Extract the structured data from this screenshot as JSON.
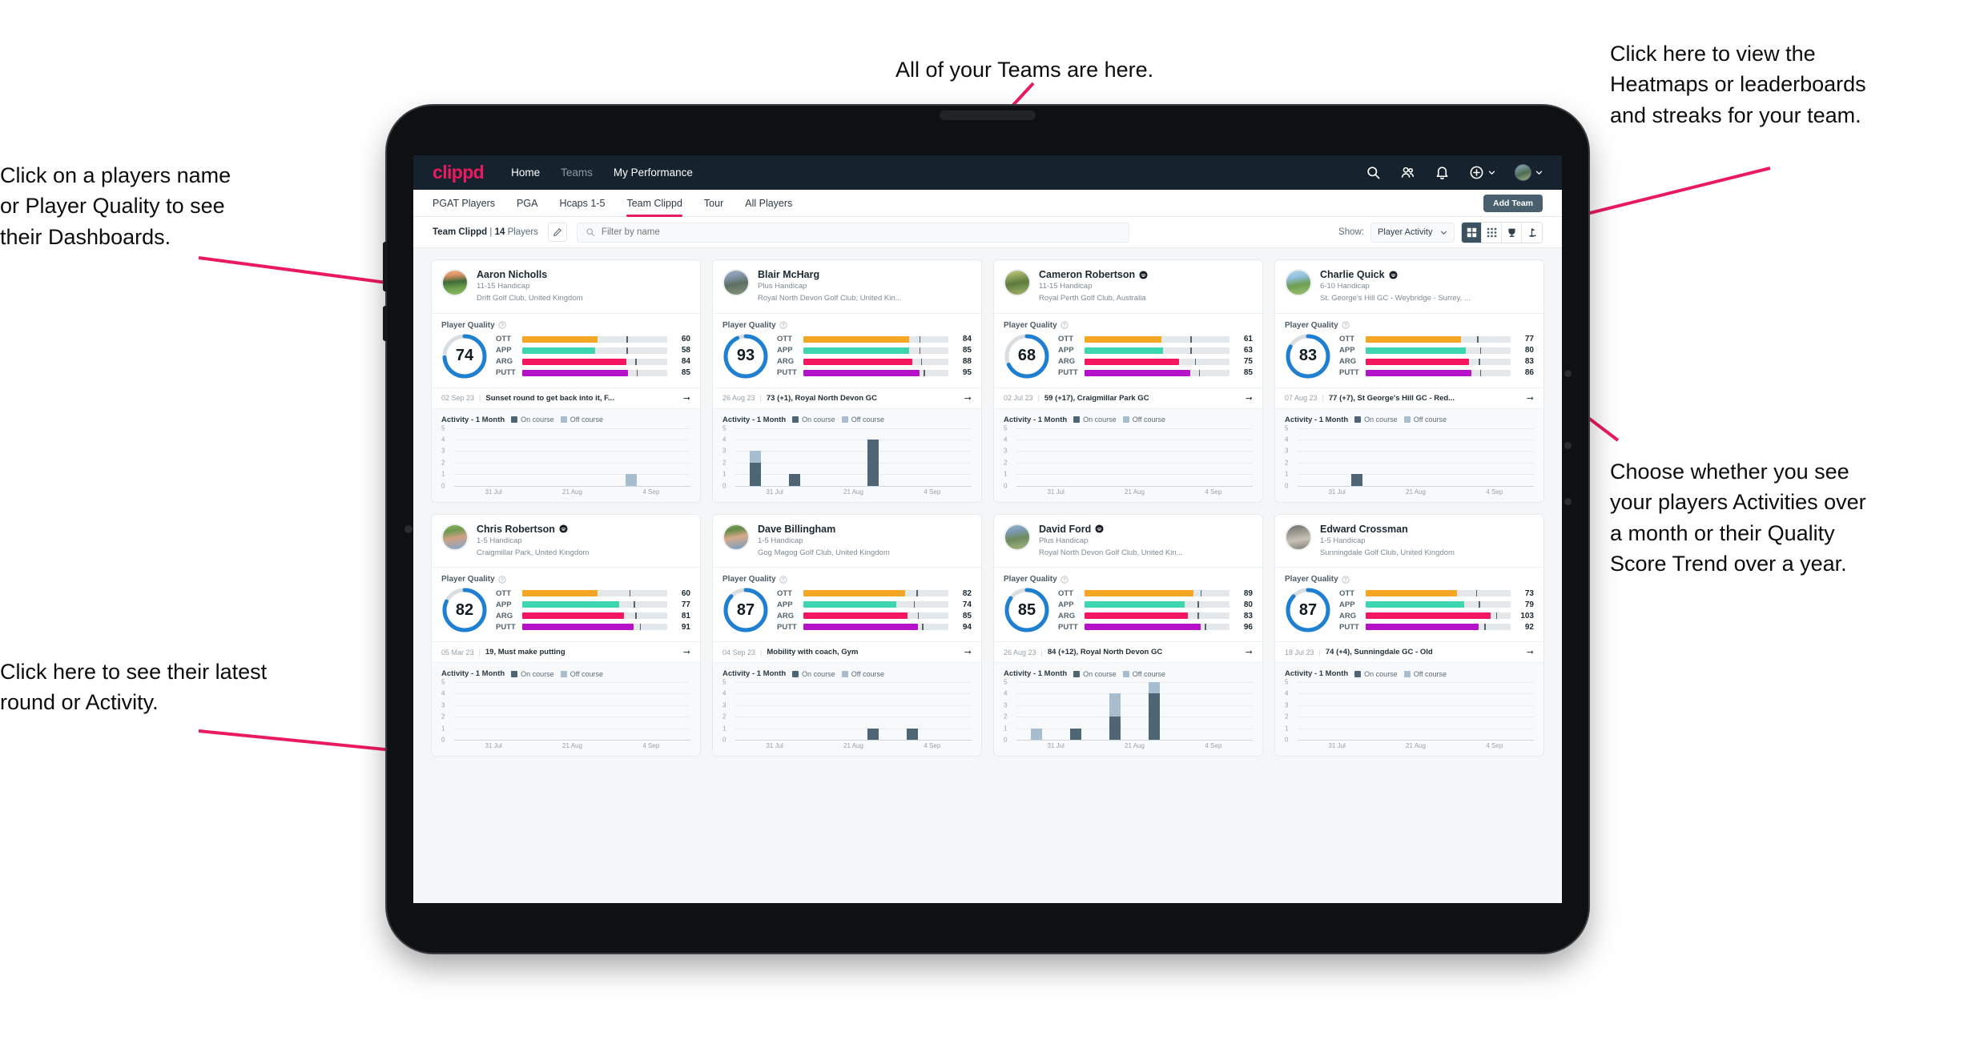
{
  "annotations": [
    {
      "id": "players-name",
      "text": "Click on a players name\nor Player Quality to see\ntheir Dashboards."
    },
    {
      "id": "teams-here",
      "text": "All of your Teams are here."
    },
    {
      "id": "heatmaps",
      "text": "Click here to view the\nHeatmaps or leaderboards\nand streaks for your team."
    },
    {
      "id": "choose-view",
      "text": "Choose whether you see\nyour players Activities over\na month or their Quality\nScore Trend over a year."
    },
    {
      "id": "latest-round",
      "text": "Click here to see their latest\nround or Activity."
    }
  ],
  "accent": "#ea1a5f",
  "navbar": {
    "brand": "clippd",
    "links": [
      {
        "label": "Home",
        "active": true
      },
      {
        "label": "Teams",
        "active": false
      },
      {
        "label": "My Performance",
        "active": true
      }
    ],
    "icons": [
      "search-icon",
      "people-icon",
      "bell-icon",
      "plus-circle-icon",
      "avatar"
    ]
  },
  "tabs": {
    "items": [
      {
        "label": "PGAT Players",
        "active": false
      },
      {
        "label": "PGA",
        "active": false
      },
      {
        "label": "Hcaps 1-5",
        "active": false
      },
      {
        "label": "Team Clippd",
        "active": true
      },
      {
        "label": "Tour",
        "active": false
      },
      {
        "label": "All Players",
        "active": false
      }
    ],
    "add_team_label": "Add Team"
  },
  "toolbar": {
    "team_name": "Team Clippd",
    "separator": "|",
    "player_count": "14",
    "players_word": "Players",
    "search_placeholder": "Filter by name",
    "search_value": "",
    "show_label": "Show:",
    "show_value": "Player Activity",
    "views": [
      {
        "name": "grid-large-view",
        "active": true
      },
      {
        "name": "grid-small-view",
        "active": false
      },
      {
        "name": "trophy-view",
        "active": false
      },
      {
        "name": "golf-flag-view",
        "active": false
      }
    ]
  },
  "card_labels": {
    "player_quality": "Player Quality",
    "activity_title": "Activity - 1 Month",
    "legend_on": "On course",
    "legend_off": "Off course"
  },
  "chart_data": {
    "type": "bar",
    "title": "Activity - 1 Month",
    "ylim": [
      0,
      5
    ],
    "yticks": [
      5,
      4,
      3,
      2,
      1,
      0
    ],
    "xticks": [
      "31 Jul",
      "21 Aug",
      "4 Sep"
    ],
    "series_names": [
      "On course",
      "Off course"
    ],
    "colors": {
      "on_course": "#4e6575",
      "off_course": "#a7bed0"
    },
    "charts": [
      {
        "player": "Aaron Nicholls",
        "bars": [
          {
            "on": 0,
            "off": 0
          },
          {
            "on": 0,
            "off": 0
          },
          {
            "on": 0,
            "off": 0
          },
          {
            "on": 0,
            "off": 0
          },
          {
            "on": 0,
            "off": 1
          },
          {
            "on": 0,
            "off": 0
          }
        ]
      },
      {
        "player": "Blair McHarg",
        "bars": [
          {
            "on": 2,
            "off": 1
          },
          {
            "on": 1,
            "off": 0
          },
          {
            "on": 0,
            "off": 0
          },
          {
            "on": 4,
            "off": 0
          },
          {
            "on": 0,
            "off": 0
          },
          {
            "on": 0,
            "off": 0
          }
        ]
      },
      {
        "player": "Cameron Robertson",
        "bars": [
          {
            "on": 0,
            "off": 0
          },
          {
            "on": 0,
            "off": 0
          },
          {
            "on": 0,
            "off": 0
          },
          {
            "on": 0,
            "off": 0
          },
          {
            "on": 0,
            "off": 0
          },
          {
            "on": 0,
            "off": 0
          }
        ]
      },
      {
        "player": "Charlie Quick",
        "bars": [
          {
            "on": 0,
            "off": 0
          },
          {
            "on": 1,
            "off": 0
          },
          {
            "on": 0,
            "off": 0
          },
          {
            "on": 0,
            "off": 0
          },
          {
            "on": 0,
            "off": 0
          },
          {
            "on": 0,
            "off": 0
          }
        ]
      },
      {
        "player": "Chris Robertson",
        "bars": [
          {
            "on": 0,
            "off": 0
          },
          {
            "on": 0,
            "off": 0
          },
          {
            "on": 0,
            "off": 0
          },
          {
            "on": 0,
            "off": 0
          },
          {
            "on": 0,
            "off": 0
          },
          {
            "on": 0,
            "off": 0
          }
        ]
      },
      {
        "player": "Dave Billingham",
        "bars": [
          {
            "on": 0,
            "off": 0
          },
          {
            "on": 0,
            "off": 0
          },
          {
            "on": 0,
            "off": 0
          },
          {
            "on": 1,
            "off": 0
          },
          {
            "on": 1,
            "off": 0
          },
          {
            "on": 0,
            "off": 0
          }
        ]
      },
      {
        "player": "David Ford",
        "bars": [
          {
            "on": 0,
            "off": 1
          },
          {
            "on": 1,
            "off": 0
          },
          {
            "on": 2,
            "off": 2
          },
          {
            "on": 4,
            "off": 1
          },
          {
            "on": 0,
            "off": 0
          },
          {
            "on": 0,
            "off": 0
          }
        ]
      },
      {
        "player": "Edward Crossman",
        "bars": [
          {
            "on": 0,
            "off": 0
          },
          {
            "on": 0,
            "off": 0
          },
          {
            "on": 0,
            "off": 0
          },
          {
            "on": 0,
            "off": 0
          },
          {
            "on": 0,
            "off": 0
          },
          {
            "on": 0,
            "off": 0
          }
        ]
      }
    ]
  },
  "stat_colors": {
    "OTT": "#f5a623",
    "APP": "#3ed6b0",
    "ARG": "#f4175f",
    "PUTT": "#b511c9",
    "ring": "#1f7fd1",
    "ring_track": "#d9dee2"
  },
  "players": [
    {
      "name": "Aaron Nicholls",
      "verified": false,
      "handicap": "11-15 Handicap",
      "club": "Drift Golf Club, United Kingdom",
      "quality": 74,
      "ring_pct": 74,
      "avatar_css": "linear-gradient(175deg,#f0b57e 0%,#d98f63 22%,#3f6b3a 46%,#6ea04e 72%,#8dba63 100%)",
      "stats": [
        {
          "label": "OTT",
          "value": 60,
          "fill": 52,
          "tick": 72
        },
        {
          "label": "APP",
          "value": 58,
          "fill": 50,
          "tick": 72
        },
        {
          "label": "ARG",
          "value": 84,
          "fill": 72,
          "tick": 78
        },
        {
          "label": "PUTT",
          "value": 85,
          "fill": 73,
          "tick": 79
        }
      ],
      "round": {
        "date": "02 Sep 23",
        "desc": "Sunset round to get back into it, F..."
      }
    },
    {
      "name": "Blair McHarg",
      "verified": false,
      "handicap": "Plus Handicap",
      "club": "Royal North Devon Golf Club, United Kin...",
      "quality": 93,
      "ring_pct": 93,
      "avatar_css": "linear-gradient(170deg,#9fb4c6 0%,#7f93a5 30%,#5d6f62 55%,#86977c 100%)",
      "stats": [
        {
          "label": "OTT",
          "value": 84,
          "fill": 73,
          "tick": 80
        },
        {
          "label": "APP",
          "value": 85,
          "fill": 73,
          "tick": 80
        },
        {
          "label": "ARG",
          "value": 88,
          "fill": 75,
          "tick": 81
        },
        {
          "label": "PUTT",
          "value": 95,
          "fill": 80,
          "tick": 83
        }
      ],
      "round": {
        "date": "26 Aug 23",
        "desc": "73 (+1), Royal North Devon GC"
      }
    },
    {
      "name": "Cameron Robertson",
      "verified": true,
      "handicap": "11-15 Handicap",
      "club": "Royal Perth Golf Club, Australia",
      "quality": 68,
      "ring_pct": 68,
      "avatar_css": "linear-gradient(170deg,#c8d088 0%,#8fa05a 28%,#5c7a3c 52%,#a8b96f 100%)",
      "stats": [
        {
          "label": "OTT",
          "value": 61,
          "fill": 53,
          "tick": 73
        },
        {
          "label": "APP",
          "value": 63,
          "fill": 54,
          "tick": 73
        },
        {
          "label": "ARG",
          "value": 75,
          "fill": 65,
          "tick": 76
        },
        {
          "label": "PUTT",
          "value": 85,
          "fill": 73,
          "tick": 79
        }
      ],
      "round": {
        "date": "02 Jul 23",
        "desc": "59 (+17), Craigmillar Park GC"
      }
    },
    {
      "name": "Charlie Quick",
      "verified": true,
      "handicap": "6-10 Handicap",
      "club": "St. George's Hill GC - Weybridge - Surrey, ...",
      "quality": 83,
      "ring_pct": 83,
      "avatar_css": "linear-gradient(170deg,#b9d7ea 0%,#8fc0dd 30%,#6d9e52 58%,#9dc472 100%)",
      "stats": [
        {
          "label": "OTT",
          "value": 77,
          "fill": 66,
          "tick": 77
        },
        {
          "label": "APP",
          "value": 80,
          "fill": 69,
          "tick": 79
        },
        {
          "label": "ARG",
          "value": 83,
          "fill": 71,
          "tick": 78
        },
        {
          "label": "PUTT",
          "value": 86,
          "fill": 73,
          "tick": 79
        }
      ],
      "round": {
        "date": "07 Aug 23",
        "desc": "77 (+7), St George's Hill GC - Red..."
      }
    },
    {
      "name": "Chris Robertson",
      "verified": true,
      "handicap": "1-5 Handicap",
      "club": "Craigmillar Park, United Kingdom",
      "quality": 82,
      "ring_pct": 82,
      "avatar_css": "linear-gradient(170deg,#89b45f 0%,#6f9a4c 25%,#cfa083 52%,#7fa8cf 100%)",
      "stats": [
        {
          "label": "OTT",
          "value": 60,
          "fill": 52,
          "tick": 74
        },
        {
          "label": "APP",
          "value": 77,
          "fill": 67,
          "tick": 77
        },
        {
          "label": "ARG",
          "value": 81,
          "fill": 70,
          "tick": 78
        },
        {
          "label": "PUTT",
          "value": 91,
          "fill": 77,
          "tick": 81
        }
      ],
      "round": {
        "date": "05 Mar 23",
        "desc": "19, Must make putting"
      }
    },
    {
      "name": "Dave Billingham",
      "verified": false,
      "handicap": "1-5 Handicap",
      "club": "Gog Magog Golf Club, United Kingdom",
      "quality": 87,
      "ring_pct": 87,
      "avatar_css": "linear-gradient(170deg,#7fa95a 0%,#628c47 22%,#d8a98c 50%,#6f9ec4 100%)",
      "stats": [
        {
          "label": "OTT",
          "value": 82,
          "fill": 70,
          "tick": 78
        },
        {
          "label": "APP",
          "value": 74,
          "fill": 64,
          "tick": 76
        },
        {
          "label": "ARG",
          "value": 85,
          "fill": 72,
          "tick": 79
        },
        {
          "label": "PUTT",
          "value": 94,
          "fill": 79,
          "tick": 82
        }
      ],
      "round": {
        "date": "04 Sep 23",
        "desc": "Mobility with coach, Gym"
      }
    },
    {
      "name": "David Ford",
      "verified": true,
      "handicap": "Plus Handicap",
      "club": "Royal North Devon Golf Club, United Kin...",
      "quality": 85,
      "ring_pct": 85,
      "avatar_css": "linear-gradient(170deg,#9cb8cf 0%,#7d9bb4 25%,#6e8a5e 55%,#a6b884 100%)",
      "stats": [
        {
          "label": "OTT",
          "value": 89,
          "fill": 75,
          "tick": 80
        },
        {
          "label": "APP",
          "value": 80,
          "fill": 69,
          "tick": 78
        },
        {
          "label": "ARG",
          "value": 83,
          "fill": 71,
          "tick": 78
        },
        {
          "label": "PUTT",
          "value": 96,
          "fill": 80,
          "tick": 83
        }
      ],
      "round": {
        "date": "26 Aug 23",
        "desc": "84 (+12), Royal North Devon GC"
      }
    },
    {
      "name": "Edward Crossman",
      "verified": false,
      "handicap": "1-5 Handicap",
      "club": "Sunningdale Golf Club, United Kingdom",
      "quality": 87,
      "ring_pct": 87,
      "avatar_css": "linear-gradient(170deg,#6f6f6f 0%,#9a958e 30%,#c9c2b6 60%,#7d7a74 100%)",
      "stats": [
        {
          "label": "OTT",
          "value": 73,
          "fill": 63,
          "tick": 76
        },
        {
          "label": "APP",
          "value": 79,
          "fill": 68,
          "tick": 78
        },
        {
          "label": "ARG",
          "value": 103,
          "fill": 86,
          "tick": 90
        },
        {
          "label": "PUTT",
          "value": 92,
          "fill": 78,
          "tick": 82
        }
      ],
      "round": {
        "date": "18 Jul 23",
        "desc": "74 (+4), Sunningdale GC - Old"
      }
    }
  ]
}
